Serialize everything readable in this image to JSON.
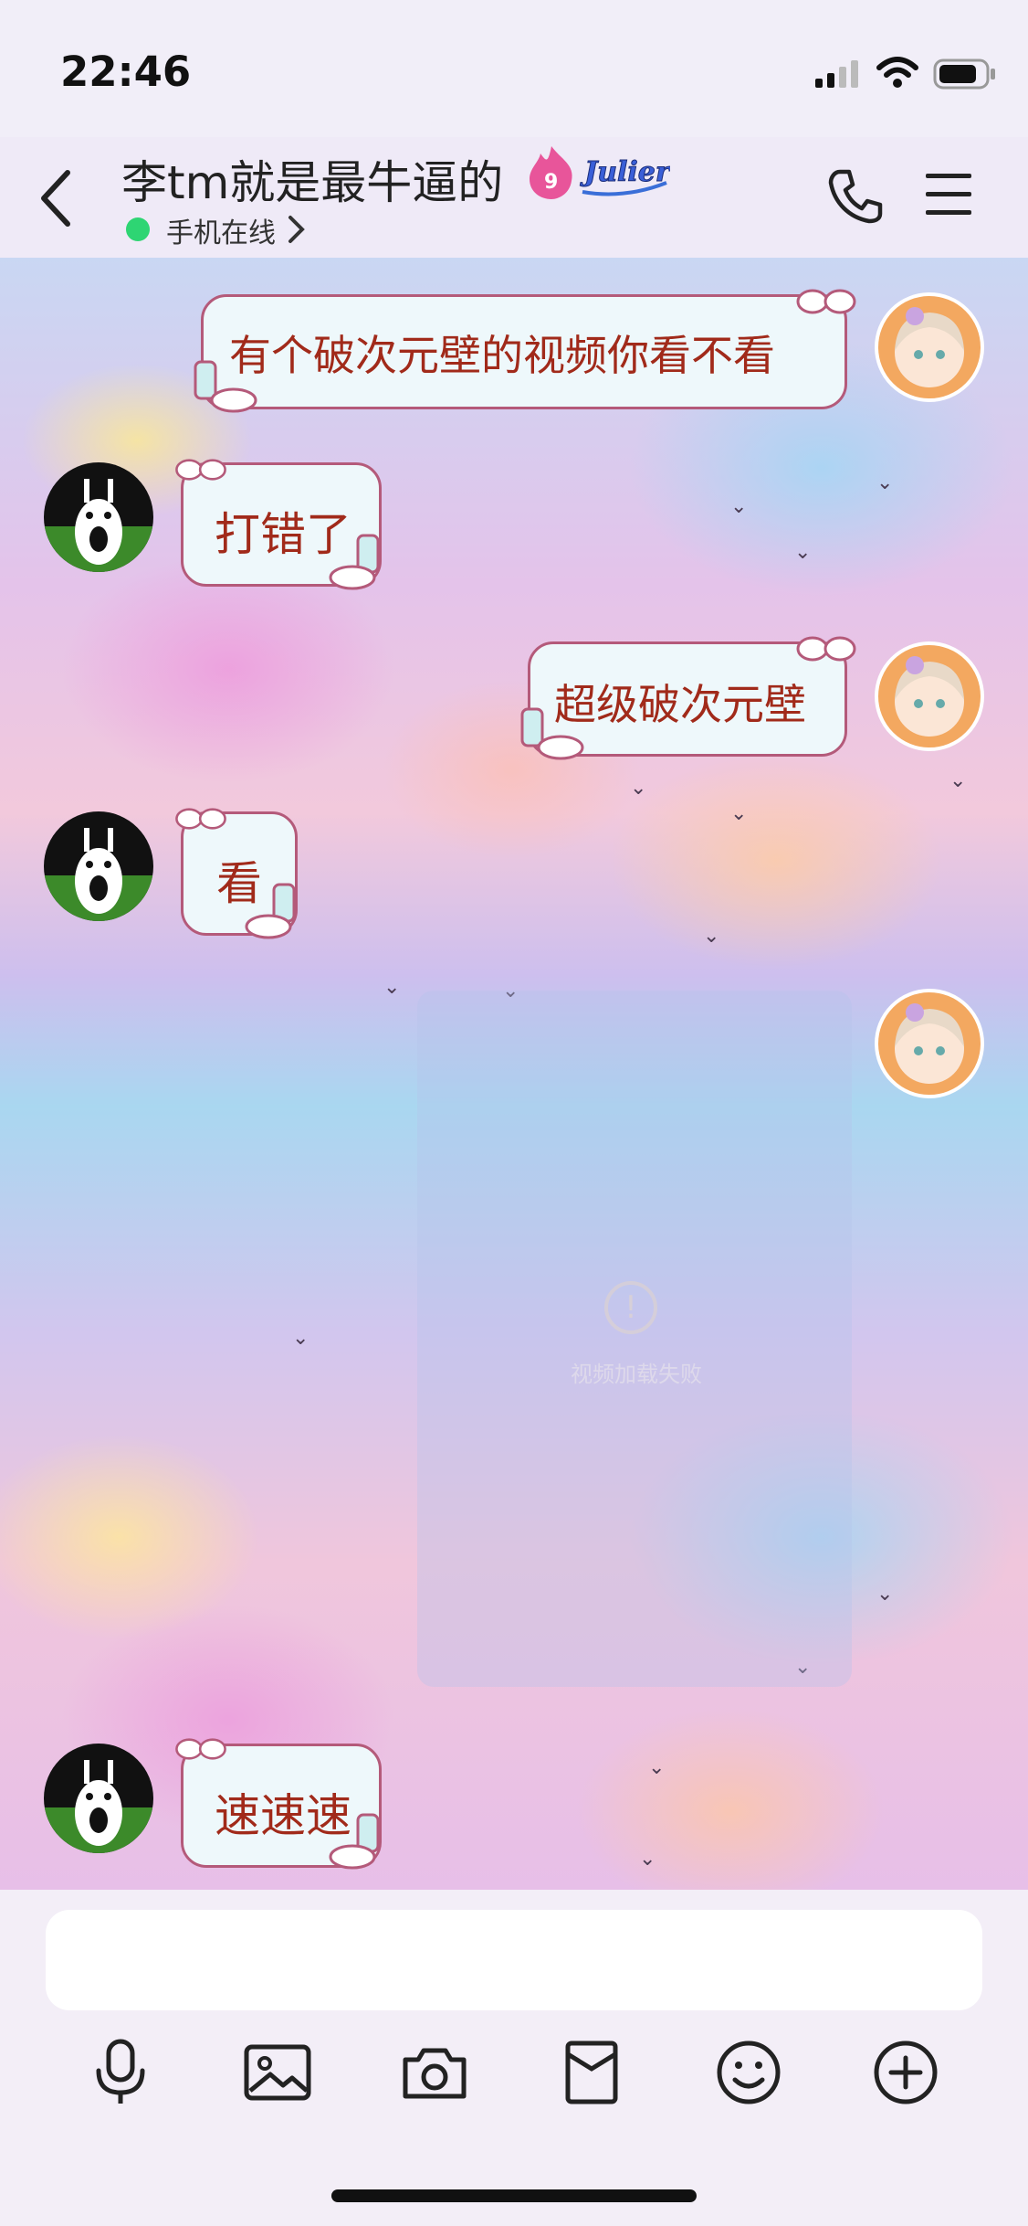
{
  "status": {
    "time": "22:46"
  },
  "header": {
    "title": "李tm就是最牛逼的",
    "status_text": "手机在线",
    "badge_text": "Julier"
  },
  "messages": [
    {
      "side": "right",
      "text": "有个破次元壁的视频你看不看"
    },
    {
      "side": "left",
      "text": "打错了"
    },
    {
      "side": "right",
      "text": "超级破次元壁"
    },
    {
      "side": "left",
      "text": "看"
    },
    {
      "side": "right",
      "type": "media",
      "text": "视频加载失败"
    },
    {
      "side": "left",
      "text": "速速速"
    }
  ],
  "toolbar": {
    "icons": [
      "microphone-icon",
      "image-icon",
      "camera-icon",
      "red-packet-icon",
      "emoji-icon",
      "plus-icon"
    ]
  },
  "colors": {
    "bubble_bg": "#eef8fb",
    "bubble_border": "#b45a7a",
    "bubble_text": "#a12a1a",
    "online": "#2ed573"
  }
}
